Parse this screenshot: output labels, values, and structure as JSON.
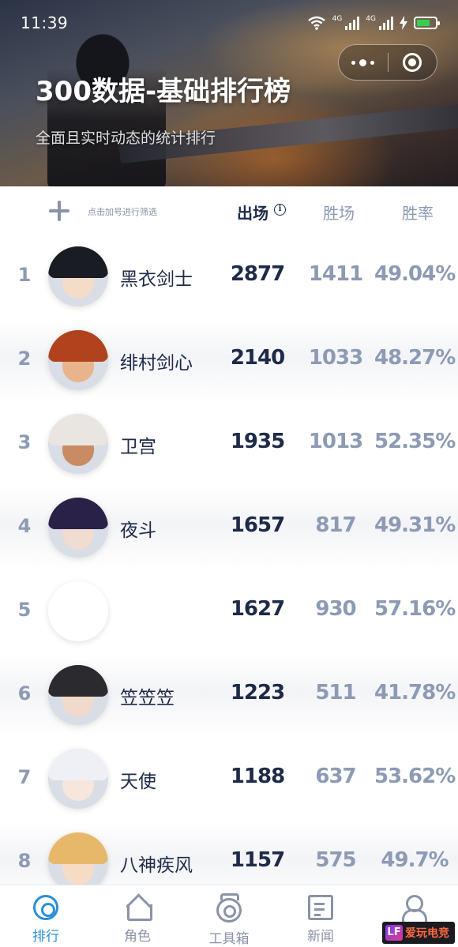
{
  "status_bar": {
    "time": "11:39",
    "signal_label_1": "4G",
    "signal_label_2": "4G"
  },
  "header": {
    "title": "300数据-基础排行榜",
    "subtitle": "全面且实时动态的统计排行"
  },
  "columns": {
    "filter_hint": "点击加号进行筛选",
    "appearances": "出场",
    "info_glyph": "i",
    "wins": "胜场",
    "win_rate": "胜率"
  },
  "rows": [
    {
      "rank": "1",
      "name": "黑衣剑士",
      "appearances": "2877",
      "wins": "1411",
      "win_rate": "49.04%",
      "hair": "#1a1c24",
      "face": "#f3dcc8"
    },
    {
      "rank": "2",
      "name": "绯村剑心",
      "appearances": "2140",
      "wins": "1033",
      "win_rate": "48.27%",
      "hair": "#b0421e",
      "face": "#e8b48c"
    },
    {
      "rank": "3",
      "name": "卫宫",
      "appearances": "1935",
      "wins": "1013",
      "win_rate": "52.35%",
      "hair": "#e9e6e2",
      "face": "#c98b62"
    },
    {
      "rank": "4",
      "name": "夜斗",
      "appearances": "1657",
      "wins": "817",
      "win_rate": "49.31%",
      "hair": "#2a2148",
      "face": "#f0dcd0"
    },
    {
      "rank": "5",
      "name": "",
      "appearances": "1627",
      "wins": "930",
      "win_rate": "57.16%",
      "hair": "#ffffff",
      "face": "#ffffff"
    },
    {
      "rank": "6",
      "name": "笠笠笠",
      "appearances": "1223",
      "wins": "511",
      "win_rate": "41.78%",
      "hair": "#2b2a2e",
      "face": "#f1d9cc"
    },
    {
      "rank": "7",
      "name": "天使",
      "appearances": "1188",
      "wins": "637",
      "win_rate": "53.62%",
      "hair": "#eef0f6",
      "face": "#f7e6dc"
    },
    {
      "rank": "8",
      "name": "八神疾风",
      "appearances": "1157",
      "wins": "575",
      "win_rate": "49.7%",
      "hair": "#e7b86a",
      "face": "#f6dcc4"
    }
  ],
  "tabs": [
    {
      "label": "排行",
      "icon": "ranking-icon",
      "active": true
    },
    {
      "label": "角色",
      "icon": "home-icon",
      "active": false
    },
    {
      "label": "工具箱",
      "icon": "toolbox-icon",
      "active": false
    },
    {
      "label": "新闻",
      "icon": "news-icon",
      "active": false
    },
    {
      "label": "我的",
      "icon": "profile-icon",
      "active": false
    }
  ],
  "watermark": {
    "logo": "LF",
    "text": "爱玩电竞"
  },
  "colors": {
    "accent": "#2d8fd6",
    "primary_text": "#1e2a48",
    "secondary_text": "#8d9ab4"
  }
}
